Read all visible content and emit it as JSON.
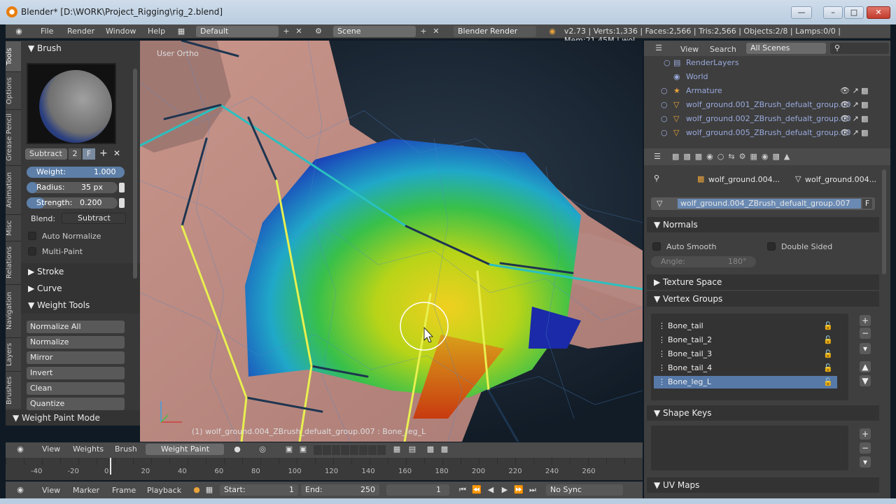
{
  "window": {
    "title": "Blender* [D:\\WORK\\Project_Rigging\\rig_2.blend]"
  },
  "menubar": {
    "menus": [
      "File",
      "Render",
      "Window",
      "Help"
    ],
    "screen_layout": "Default",
    "scene": "Scene",
    "render_engine": "Blender Render",
    "stats": "v2.73 | Verts:1,336 | Faces:2,566 | Tris:2,566 | Objects:2/8 | Lamps:0/0 | Mem:21.45M | wol"
  },
  "tool_tabs": [
    "Tools",
    "Options",
    "Grease Pencil",
    "Animation",
    "Misc",
    "Relations",
    "Navigation",
    "Layers",
    "Brushes"
  ],
  "tool_panel": {
    "brush_header": "Brush",
    "brush_name": "Subtract",
    "brush_users": "2",
    "brush_fake": "F",
    "weight": {
      "label": "Weight:",
      "value": "1.000",
      "level": 1.0
    },
    "radius": {
      "label": "Radius:",
      "value": "35 px",
      "level": 0.1
    },
    "strength": {
      "label": "Strength:",
      "value": "0.200",
      "level": 0.2
    },
    "blend_label": "Blend:",
    "blend_value": "Subtract",
    "auto_normalize": "Auto Normalize",
    "multi_paint": "Multi-Paint",
    "stroke": "Stroke",
    "curve": "Curve",
    "weight_tools": "Weight Tools",
    "tools": [
      "Normalize All",
      "Normalize",
      "Mirror",
      "Invert",
      "Clean",
      "Quantize"
    ],
    "mode_footer": "Weight Paint Mode"
  },
  "viewport": {
    "view_label": "User Ortho",
    "status": "(1) wolf_ground.004_ZBrush_defualt_group.007 : Bone_leg_L"
  },
  "view_header": {
    "items": [
      "View",
      "Weights",
      "Brush"
    ],
    "mode": "Weight Paint"
  },
  "timeline": {
    "ticks": [
      "-40",
      "-20",
      "0",
      "20",
      "40",
      "60",
      "80",
      "100",
      "120",
      "140",
      "160",
      "180",
      "200",
      "220",
      "240",
      "260"
    ],
    "current_frame": 0
  },
  "timeline_header": {
    "items": [
      "View",
      "Marker",
      "Frame",
      "Playback"
    ],
    "start_label": "Start:",
    "start_value": "1",
    "end_label": "End:",
    "end_value": "250",
    "current": "1",
    "sync": "No Sync"
  },
  "outliner": {
    "view": "View",
    "search": "Search",
    "filter": "All Scenes",
    "rows": [
      {
        "label": "RenderLayers"
      },
      {
        "label": "World"
      },
      {
        "label": "Armature"
      },
      {
        "label": "wolf_ground.001_ZBrush_defualt_group.00"
      },
      {
        "label": "wolf_ground.002_ZBrush_defualt_group.00"
      },
      {
        "label": "wolf_ground.005_ZBrush_defualt_group.00"
      }
    ]
  },
  "properties": {
    "object_name": "wolf_ground.004...",
    "mesh_name": "wolf_ground.004...",
    "data_name": "wolf_ground.004_ZBrush_defualt_group.007",
    "data_fake": "F",
    "normals": "Normals",
    "auto_smooth": "Auto Smooth",
    "double_sided": "Double Sided",
    "angle_label": "Angle:",
    "angle_value": "180°",
    "texture_space": "Texture Space",
    "vertex_groups": "Vertex Groups",
    "groups": [
      "Bone_tail",
      "Bone_tail_2",
      "Bone_tail_3",
      "Bone_tail_4",
      "Bone_leg_L"
    ],
    "shape_keys": "Shape Keys",
    "uv_maps": "UV Maps"
  }
}
